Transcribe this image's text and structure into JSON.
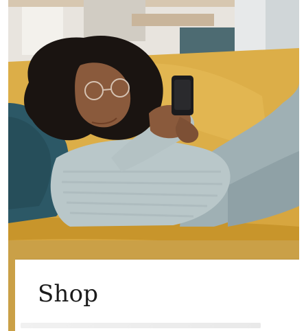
{
  "hero": {
    "image_description_icon": "hero-photo-icon",
    "colors": {
      "sofa": "#dcae48",
      "sofa_shadow": "#c8952b",
      "pillow": "#2c5866",
      "sweater": "#b9c7c9",
      "pants": "#9fb0b4",
      "hair": "#1a1411",
      "skin": "#8a5a3c",
      "phone": "#1b1b1d"
    }
  },
  "card": {
    "title": "Shop"
  }
}
